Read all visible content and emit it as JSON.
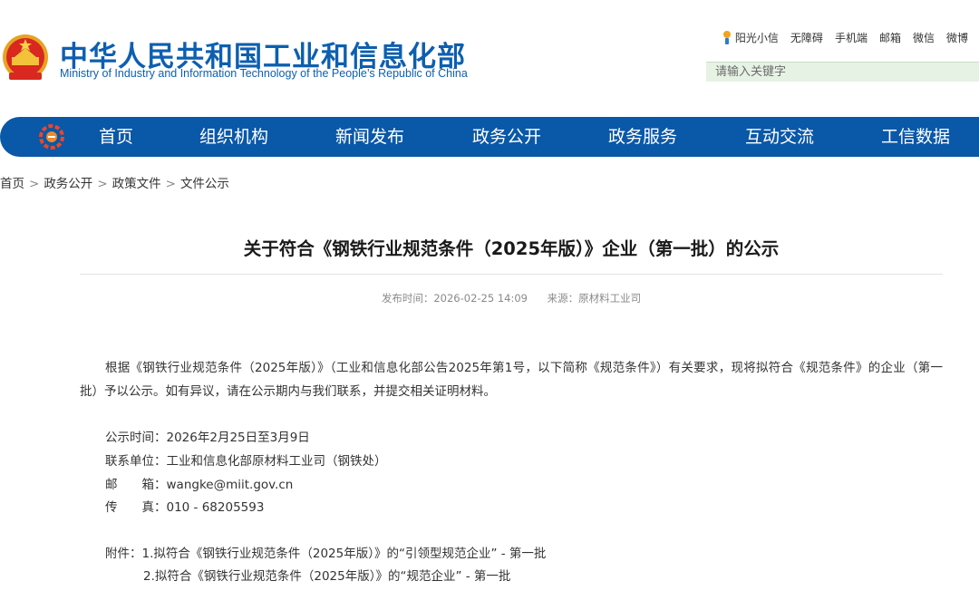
{
  "header": {
    "title": "中华人民共和国工业和信息化部",
    "subtitle": "Ministry of Industry and Information Technology of the People’s Republic of China",
    "emblem_icon": "national-emblem-icon"
  },
  "top_links": [
    "阳光小信",
    "无障碍",
    "手机端",
    "邮箱",
    "微信",
    "微博"
  ],
  "search": {
    "placeholder": "请输入关键字"
  },
  "nav": {
    "items": [
      "首页",
      "组织机构",
      "新闻发布",
      "政务公开",
      "政务服务",
      "互动交流",
      "工信数据"
    ],
    "color": "#0a58a8"
  },
  "breadcrumb": [
    "首页",
    "政务公开",
    "政策文件",
    "文件公示"
  ],
  "article": {
    "title": "关于符合《钢铁行业规范条件（2025年版）》企业（第一批）的公示",
    "publish": "发布时间：2026-02-25 14:09",
    "source": "来源：原材料工业司",
    "body": "根据《钢铁行业规范条件（2025年版）》（工业和信息化部公告2025年第1号，以下简称《规范条件》）有关要求，现将拟符合《规范条件》的企业（第一批）予以公示。如有异议，请在公示期内与我们联系，并提交相关证明材料。",
    "info": {
      "period_label": "公示时间：",
      "period": "2026年2月25日至3月9日",
      "unit_label": "联系单位：",
      "unit": "工业和信息化部原材料工业司（钢铁处）",
      "email_label": "邮　　箱：",
      "email": "wangke@miit.gov.cn",
      "fax_label": "传　　真：",
      "fax": "010 - 68205593"
    },
    "attachments_label": "附件：",
    "attachments": [
      "1.拟符合《钢铁行业规范条件（2025年版）》的“引领型规范企业” - 第一批",
      "2.拟符合《钢铁行业规范条件（2025年版）》的“规范企业” - 第一批"
    ]
  }
}
